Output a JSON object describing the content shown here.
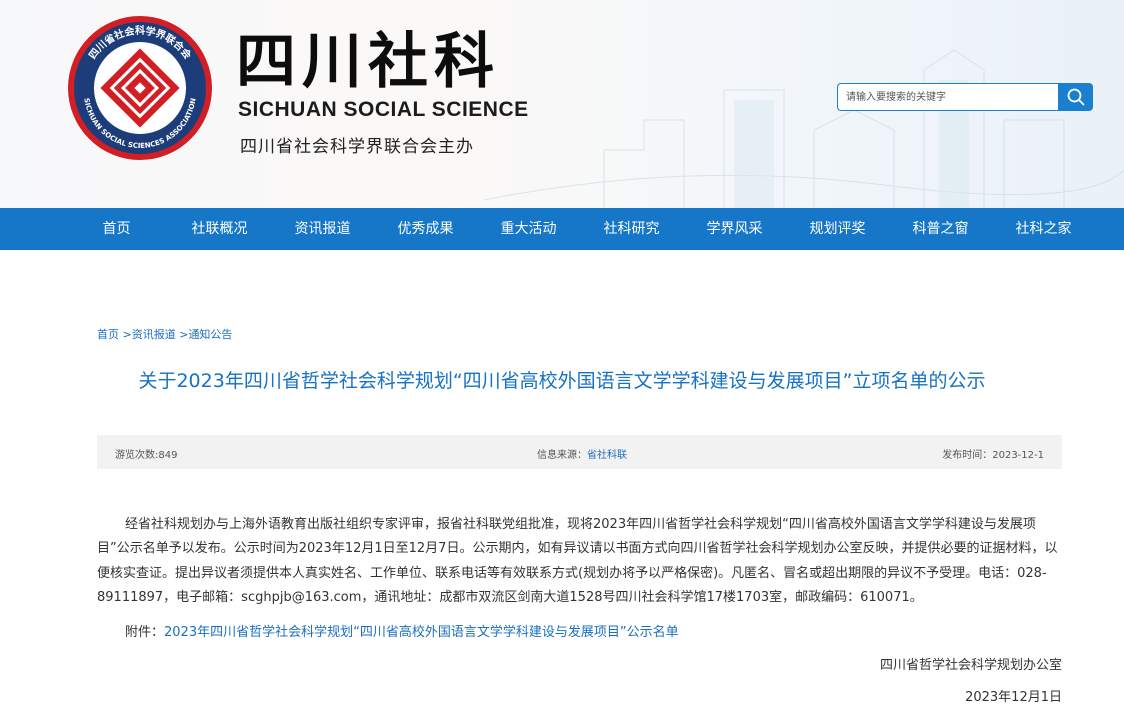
{
  "header": {
    "brand_cn": "四川社科",
    "brand_en": "SICHUAN SOCIAL SCIENCE",
    "brand_sub": "四川省社会科学界联合会主办",
    "logo_ring_top": "四川省社会科学界联合会",
    "logo_ring_bottom": "SICHUAN SOCIAL SCIENCES ASSOCIATION"
  },
  "search": {
    "placeholder": "请输入要搜索的关键字",
    "icon": "search-icon"
  },
  "nav": {
    "items": [
      {
        "label": "首页"
      },
      {
        "label": "社联概况"
      },
      {
        "label": "资讯报道"
      },
      {
        "label": "优秀成果"
      },
      {
        "label": "重大活动"
      },
      {
        "label": "社科研究"
      },
      {
        "label": "学界风采"
      },
      {
        "label": "规划评奖"
      },
      {
        "label": "科普之窗"
      },
      {
        "label": "社科之家"
      }
    ]
  },
  "breadcrumb": {
    "home": "首页",
    "sep1": " >",
    "level1": "资讯报道",
    "sep2": " >",
    "level2": "通知公告"
  },
  "article": {
    "title": "关于2023年四川省哲学社会科学规划“四川省高校外国语言文学学科建设与发展项目”立项名单的公示",
    "views": "游览次数:849",
    "source_label": "信息来源：",
    "source_value": "省社科联",
    "date": "发布时间：2023-12-1",
    "paragraph": "经省社科规划办与上海外语教育出版社组织专家评审，报省社科联党组批准，现将2023年四川省哲学社会科学规划“四川省高校外国语言文学学科建设与发展项目”公示名单予以发布。公示时间为2023年12月1日至12月7日。公示期内，如有异议请以书面方式向四川省哲学社会科学规划办公室反映，并提供必要的证据材料，以便核实查证。提出异议者须提供本人真实姓名、工作单位、联系电话等有效联系方式(规划办将予以严格保密)。凡匿名、冒名或超出期限的异议不予受理。电话：028-89111897，电子邮箱：scghpjb@163.com，通讯地址：成都市双流区剑南大道1528号四川社会科学馆17楼1703室，邮政编码：610071。",
    "attachment_label": "附件：",
    "attachment_link": "2023年四川省哲学社会科学规划“四川省高校外国语言文学学科建设与发展项目”公示名单",
    "signature": "四川省哲学社会科学规划办公室",
    "sign_date": "2023年12月1日"
  },
  "colors": {
    "nav_bg": "#1677c9",
    "link": "#1a6fbf",
    "title": "#1672c4",
    "logo_red": "#d21f26",
    "logo_navy": "#1d3d7a"
  }
}
